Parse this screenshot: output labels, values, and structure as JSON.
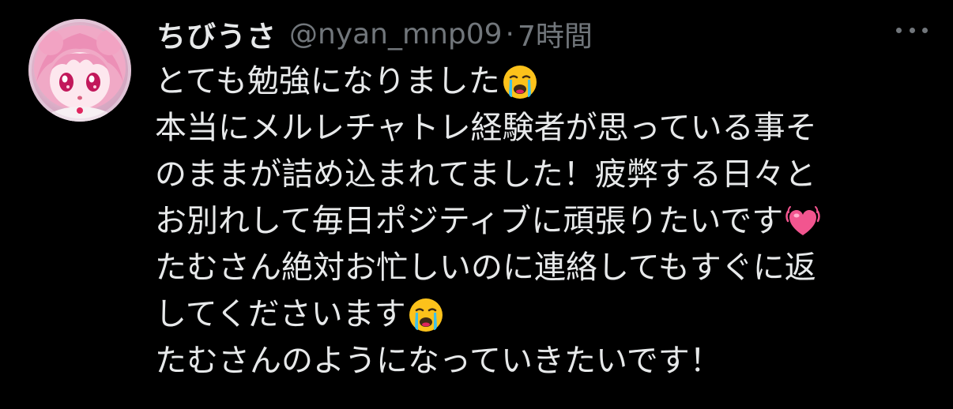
{
  "tweet": {
    "author": {
      "display_name": "ちびうさ",
      "handle": "@nyan_mnp09",
      "avatar_icon": "avatar-anime-girl-pink"
    },
    "separator": "·",
    "timestamp": "7時間",
    "more_icon": "more-horizontal-icon",
    "lines": [
      "とても勉強になりました",
      "本当にメルレチャトレ経験者が思っている事そ",
      "のままが詰め込まれてました！疲弊する日々と",
      "お別れして毎日ポジティブに頑張りたいです",
      "たむさん絶対お忙しいのに連絡してもすぐに返",
      "してくださいます",
      "たむさんのようになっていきたいです！"
    ],
    "emojis": {
      "line_0": "loudly-crying-face-emoji",
      "line_3": "beating-heart-emoji",
      "line_5": "loudly-crying-face-emoji"
    }
  },
  "colors": {
    "background": "#000000",
    "text_primary": "#e7e9ea",
    "text_secondary": "#71767b",
    "emoji_face": "#fcc21b",
    "emoji_tears": "#40c0e7",
    "emoji_heart": "#f2558f"
  }
}
